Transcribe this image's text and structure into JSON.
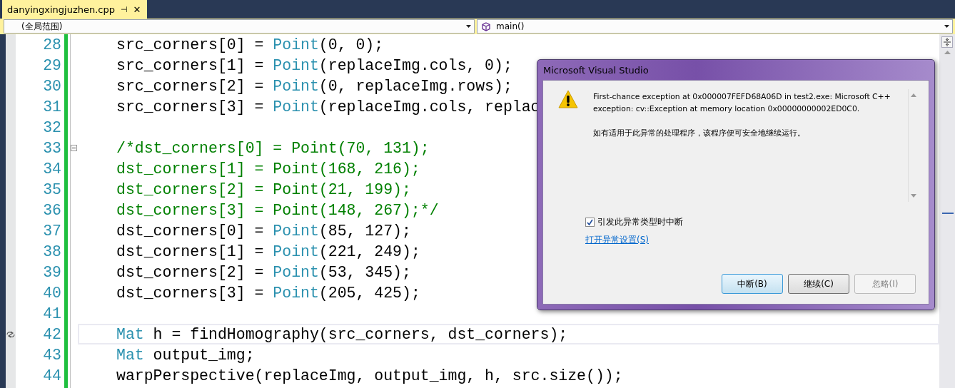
{
  "tab": {
    "title": "danyingxingjuzhen.cpp",
    "pin": "⊣",
    "close": "✕",
    "selected": true
  },
  "nav": {
    "scope": "(全局范围)",
    "member": "main()"
  },
  "lines": [
    {
      "number": "28",
      "current": false,
      "fold": false,
      "segments": [
        {
          "kind": "plain",
          "text": "src_corners[0] = "
        },
        {
          "kind": "type",
          "text": "Point"
        },
        {
          "kind": "plain",
          "text": "(0, 0);"
        }
      ]
    },
    {
      "number": "29",
      "current": false,
      "fold": false,
      "segments": [
        {
          "kind": "plain",
          "text": "src_corners[1] = "
        },
        {
          "kind": "type",
          "text": "Point"
        },
        {
          "kind": "plain",
          "text": "(replaceImg.cols, 0);"
        }
      ]
    },
    {
      "number": "30",
      "current": false,
      "fold": false,
      "segments": [
        {
          "kind": "plain",
          "text": "src_corners[2] = "
        },
        {
          "kind": "type",
          "text": "Point"
        },
        {
          "kind": "plain",
          "text": "(0, replaceImg.rows);"
        }
      ]
    },
    {
      "number": "31",
      "current": false,
      "fold": false,
      "segments": [
        {
          "kind": "plain",
          "text": "src_corners[3] = "
        },
        {
          "kind": "type",
          "text": "Point"
        },
        {
          "kind": "plain",
          "text": "(replaceImg.cols, replac"
        }
      ]
    },
    {
      "number": "32",
      "current": false,
      "fold": false
    },
    {
      "number": "33",
      "current": false,
      "fold": true,
      "segments": [
        {
          "kind": "comment",
          "text": "/*dst_corners[0] = Point(70, 131);"
        }
      ]
    },
    {
      "number": "34",
      "current": false,
      "fold": false,
      "segments": [
        {
          "kind": "comment",
          "text": "dst_corners[1] = Point(168, 216);"
        }
      ]
    },
    {
      "number": "35",
      "current": false,
      "fold": false,
      "segments": [
        {
          "kind": "comment",
          "text": "dst_corners[2] = Point(21, 199);"
        }
      ]
    },
    {
      "number": "36",
      "current": false,
      "fold": false,
      "segments": [
        {
          "kind": "comment",
          "text": "dst_corners[3] = Point(148, 267);*/"
        }
      ]
    },
    {
      "number": "37",
      "current": false,
      "fold": false,
      "segments": [
        {
          "kind": "plain",
          "text": "dst_corners[0] = "
        },
        {
          "kind": "type",
          "text": "Point"
        },
        {
          "kind": "plain",
          "text": "(85, 127);"
        }
      ]
    },
    {
      "number": "38",
      "current": false,
      "fold": false,
      "segments": [
        {
          "kind": "plain",
          "text": "dst_corners[1] = "
        },
        {
          "kind": "type",
          "text": "Point"
        },
        {
          "kind": "plain",
          "text": "(221, 249);"
        }
      ]
    },
    {
      "number": "39",
      "current": false,
      "fold": false,
      "segments": [
        {
          "kind": "plain",
          "text": "dst_corners[2] = "
        },
        {
          "kind": "type",
          "text": "Point"
        },
        {
          "kind": "plain",
          "text": "(53, 345);"
        }
      ]
    },
    {
      "number": "40",
      "current": false,
      "fold": false,
      "segments": [
        {
          "kind": "plain",
          "text": "dst_corners[3] = "
        },
        {
          "kind": "type",
          "text": "Point"
        },
        {
          "kind": "plain",
          "text": "(205, 425);"
        }
      ]
    },
    {
      "number": "41",
      "current": false,
      "fold": false
    },
    {
      "number": "42",
      "current": true,
      "fold": false,
      "segments": [
        {
          "kind": "type",
          "text": "Mat"
        },
        {
          "kind": "plain",
          "text": " h = findHomography(src_corners, dst_corners);"
        }
      ]
    },
    {
      "number": "43",
      "current": false,
      "fold": false,
      "segments": [
        {
          "kind": "type",
          "text": "Mat"
        },
        {
          "kind": "plain",
          "text": " output_img;"
        }
      ]
    },
    {
      "number": "44",
      "current": false,
      "fold": false,
      "segments": [
        {
          "kind": "plain",
          "text": "warpPerspective(replaceImg, output_img, h, src.size());"
        }
      ]
    }
  ],
  "dialog": {
    "title": "Microsoft Visual Studio",
    "message": "First-chance exception at 0x000007FEFD68A06D in test2.exe: Microsoft C++ exception: cv::Exception at memory location 0x00000000002ED0C0.",
    "note": "如有适用于此异常的处理程序，该程序便可安全地继续运行。",
    "checkbox": {
      "label": "引发此异常类型时中断",
      "checked": true
    },
    "link": "打开异常设置(S)",
    "buttons": [
      {
        "label": "中断(B)",
        "default": true,
        "disabled": false
      },
      {
        "label": "继续(C)",
        "default": false,
        "disabled": false
      },
      {
        "label": "忽略(I)",
        "default": false,
        "disabled": true
      }
    ]
  }
}
